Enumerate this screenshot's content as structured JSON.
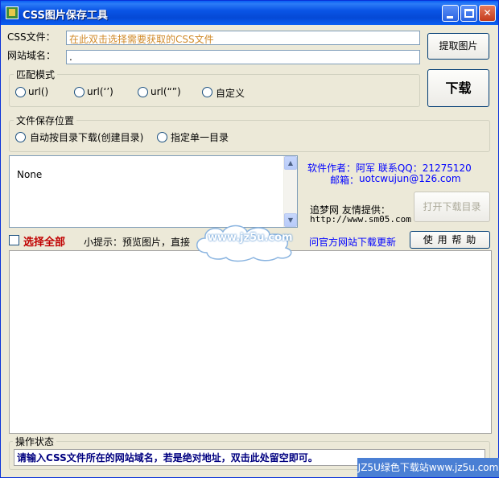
{
  "window": {
    "title": "CSS图片保存工具",
    "min_icon": "minimize-icon",
    "max_icon": "maximize-icon",
    "close_glyph": "✕"
  },
  "fields": {
    "css_label": "CSS文件：",
    "css_value": "在此双击选择需要获取的CSS文件",
    "domain_label": "网站域名：",
    "domain_value": "."
  },
  "buttons": {
    "fetch": "提取图片",
    "download": "下载",
    "open_dir": "打开下载目录",
    "help": "使 用 帮 助"
  },
  "match_mode": {
    "title": "匹配模式",
    "options": [
      "url()",
      "url(‘’)",
      "url(“”)",
      "自定义"
    ]
  },
  "save_location": {
    "title": "文件保存位置",
    "options": [
      "自动按目录下载(创建目录)",
      "指定单一目录"
    ]
  },
  "preview": {
    "content": "None"
  },
  "author_info": {
    "author_line": "软件作者：阿军  联系QQ：21275120",
    "email_label": "邮箱：",
    "email": "uotcwujun@126.com",
    "site_line": "追梦网 友情提供：",
    "site_url": "http://www.sm05.com",
    "update_link": "问官方网站下载更新"
  },
  "select_all": {
    "label": "选择全部"
  },
  "tip": {
    "text": "小提示：预览图片，直接"
  },
  "status": {
    "title": "操作状态",
    "message": "请输入CSS文件所在的网站域名，若是绝对地址，双击此处留空即可。"
  },
  "overlay": {
    "cloud_text": "www.jz5u.com",
    "watermark": "JZ5U绿色下载站www.jz5u.com"
  },
  "colors": {
    "title_bar": "#0a55e6",
    "css_value_text": "#d08a2a",
    "link_blue": "#0000ff",
    "status_text": "#000080",
    "select_all_red": "#c00000"
  }
}
